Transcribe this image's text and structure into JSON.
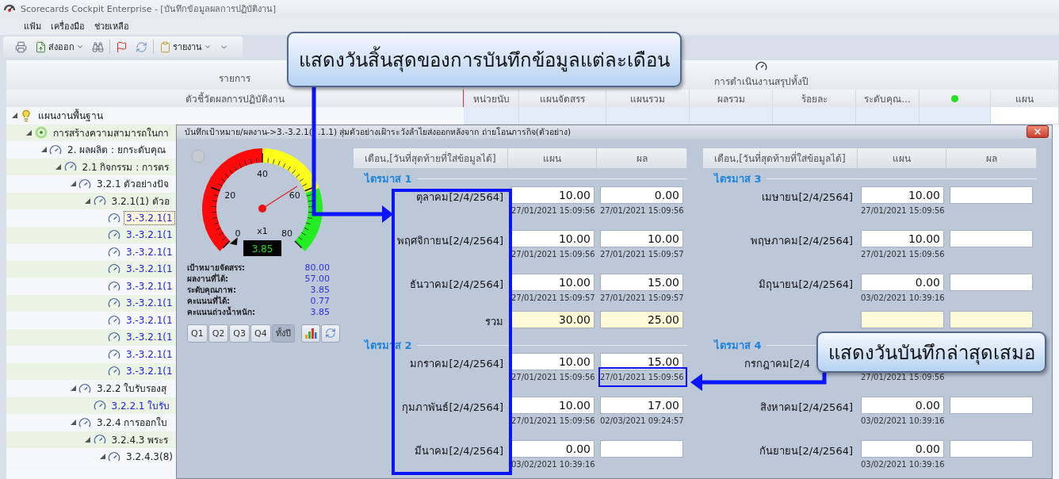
{
  "window": {
    "title": "Scorecards Cockpit Enterprise - [บันทึกข้อมูลผลการปฏิบัติงาน]"
  },
  "menu": [
    "แฟ้ม",
    "เครื่องมือ",
    "ช่วยเหลือ"
  ],
  "toolbar": [
    {
      "kind": "printer"
    },
    {
      "kind": "export",
      "label": "ส่งออก",
      "dropdown": true
    },
    {
      "kind": "binoculars"
    },
    {
      "kind": "separator"
    },
    {
      "kind": "flag"
    },
    {
      "kind": "refresh"
    },
    {
      "kind": "separator"
    },
    {
      "kind": "clipboard",
      "label": "รายงาน",
      "dropdown": true
    },
    {
      "kind": "overflow"
    }
  ],
  "grid": {
    "header_top": [
      "รายการ",
      "การดำเนินงานสรุปทั้งปี"
    ],
    "columns": [
      {
        "kind": "text",
        "label": "ตัวชี้วัดผลการปฏิบัติงาน"
      },
      {
        "kind": "text",
        "label": "หน่วยนับ"
      },
      {
        "kind": "text",
        "label": "แผนจัดสรร"
      },
      {
        "kind": "text",
        "label": "แผนรวม"
      },
      {
        "kind": "text",
        "label": "ผลรวม"
      },
      {
        "kind": "text",
        "label": "ร้อยละ"
      },
      {
        "kind": "text",
        "label": "ระดับคุณ..."
      },
      {
        "kind": "dot"
      },
      {
        "kind": "text",
        "label": "แผน"
      }
    ]
  },
  "tree": [
    {
      "label": "แผนงานพื้นฐาน",
      "kind": "bulb",
      "expanded": true,
      "selected": false,
      "children": [
        {
          "label": "การสร้างความสามารถในกา",
          "kind": "target",
          "expanded": true,
          "selected": false,
          "children": [
            {
              "label": "2. ผลผลิต : ยกระดับคุณ",
              "kind": "gauge",
              "expanded": true,
              "selected": false,
              "children": [
                {
                  "label": "2.1 กิจกรรม : การตร",
                  "kind": "gauge",
                  "expanded": true,
                  "selected": false,
                  "children": [
                    {
                      "label": "3.2.1 ตัวอย่างปัจ",
                      "kind": "gauge",
                      "expanded": true,
                      "selected": false,
                      "children": [
                        {
                          "label": "3.2.1(1) ตัวอ",
                          "kind": "gauge",
                          "expanded": true,
                          "selected": false,
                          "children": [
                            {
                              "label": "3.-3.2.1(1",
                              "kind": "gauge",
                              "selected": true
                            },
                            {
                              "label": "3.-3.2.1(1",
                              "kind": "gauge",
                              "selected": false
                            },
                            {
                              "label": "3.-3.2.1(1",
                              "kind": "gauge",
                              "selected": false
                            },
                            {
                              "label": "3.-3.2.1(1",
                              "kind": "gauge",
                              "selected": false
                            },
                            {
                              "label": "3.-3.2.1(1",
                              "kind": "gauge",
                              "selected": false
                            },
                            {
                              "label": "3.-3.2.1(1",
                              "kind": "gauge",
                              "selected": false
                            },
                            {
                              "label": "3.-3.2.1(1",
                              "kind": "gauge",
                              "selected": false
                            },
                            {
                              "label": "3.-3.2.1(1",
                              "kind": "gauge",
                              "selected": false
                            },
                            {
                              "label": "3.-3.2.1(1",
                              "kind": "gauge",
                              "selected": false
                            },
                            {
                              "label": "3.-3.2.1(1",
                              "kind": "gauge",
                              "selected": false
                            }
                          ]
                        }
                      ]
                    },
                    {
                      "label": "3.2.2 ใบรับรองสุ",
                      "kind": "gauge",
                      "expanded": true,
                      "selected": false,
                      "children": [
                        {
                          "label": "3.2.2.1 ใบรับ",
                          "kind": "gauge",
                          "selected": false
                        }
                      ]
                    },
                    {
                      "label": "3.2.4 การออกใบ",
                      "kind": "gauge",
                      "expanded": true,
                      "selected": false,
                      "children": [
                        {
                          "label": "3.2.4.3 พระร",
                          "kind": "gauge",
                          "expanded": true,
                          "selected": false,
                          "children": [
                            {
                              "label": "3.2.4.3(8)",
                              "kind": "gauge",
                              "expanded": true,
                              "selected": false
                            }
                          ]
                        }
                      ]
                    }
                  ]
                }
              ]
            }
          ]
        }
      ]
    }
  ],
  "dialog": {
    "title": [
      "บันทึกเป้าหมาย/ผลงาน->3.-3.2.1(",
      ".1.1) สุ่มตัวอย่างเฝ้าระวังลำไยส่งออกหลังจาก ถ่ายโอนภารกิจ(ตัวอย่าง)"
    ],
    "gauge": {
      "scale": [
        "0",
        "20",
        "40",
        "60",
        "80"
      ],
      "multiplier": "x1",
      "readout": "3.85",
      "level": 0.7125
    },
    "stats": [
      {
        "label": "เป้าหมายจัดสรร:",
        "value": "80.00"
      },
      {
        "label": "ผลงานที่ได้:",
        "value": "57.00"
      },
      {
        "label": "ระดับคุณภาพ:",
        "value": "3.85"
      },
      {
        "label": "คะแนนที่ได้:",
        "value": "0.77"
      },
      {
        "label": "คะแนนถ่วงน้ำหนัก:",
        "value": "3.85"
      }
    ],
    "periods": [
      {
        "label": "Q1",
        "selected": false
      },
      {
        "label": "Q2",
        "selected": false
      },
      {
        "label": "Q3",
        "selected": false
      },
      {
        "label": "Q4",
        "selected": false
      },
      {
        "label": "ทั้งปี",
        "selected": true
      }
    ],
    "tables": [
      {
        "columns": [
          "เดือน,[วันที่สุดท้ายที่ใส่ข้อมูลได้]",
          "แผน",
          "ผล"
        ],
        "quarters": [
          {
            "title": "ไตรมาส 1",
            "rows": [
              {
                "kind": "month",
                "label": "ตุลาคม[2/4/2564]",
                "plan": {
                  "value": "10.00",
                  "date": "27/01/2021 15:09:56"
                },
                "result": {
                  "value": "0.00",
                  "date": "27/01/2021 15:09:56"
                }
              },
              {
                "kind": "month",
                "label": "พฤศจิกายน[2/4/2564]",
                "plan": {
                  "value": "10.00",
                  "date": "27/01/2021 15:09:56"
                },
                "result": {
                  "value": "10.00",
                  "date": "27/01/2021 15:09:57"
                }
              },
              {
                "kind": "month",
                "label": "ธันวาคม[2/4/2564]",
                "plan": {
                  "value": "10.00",
                  "date": "27/01/2021 15:09:57"
                },
                "result": {
                  "value": "15.00",
                  "date": "27/01/2021 15:09:57"
                }
              },
              {
                "kind": "total",
                "label": "รวม",
                "plan": {
                  "value": "30.00"
                },
                "result": {
                  "value": "25.00"
                }
              }
            ]
          },
          {
            "title": "ไตรมาส 2",
            "rows": [
              {
                "kind": "month",
                "label": "มกราคม[2/4/2564]",
                "plan": {
                  "value": "10.00",
                  "date": "27/01/2021 15:09:56"
                },
                "result": {
                  "value": "15.00",
                  "date": "27/01/2021 15:09:56"
                }
              },
              {
                "kind": "month",
                "label": "กุมภาพันธ์[2/4/2564]",
                "plan": {
                  "value": "10.00",
                  "date": "27/01/2021 15:09:56"
                },
                "result": {
                  "value": "17.00",
                  "date": "02/03/2021 09:24:57"
                }
              },
              {
                "kind": "month",
                "label": "มีนาคม[2/4/2564]",
                "plan": {
                  "value": "0.00",
                  "date": "03/02/2021 10:39:16"
                }
              }
            ]
          }
        ]
      },
      {
        "columns": [
          "เดือน,[วันที่สุดท้ายที่ใส่ข้อมูลได้]",
          "แผน",
          "ผล"
        ],
        "quarters": [
          {
            "title": "ไตรมาส 3",
            "rows": [
              {
                "kind": "month",
                "label": "เมษายน[2/4/2564]",
                "plan": {
                  "value": "10.00",
                  "date": "27/01/2021 15:09:56"
                }
              },
              {
                "kind": "month",
                "label": "พฤษภาคม[2/4/2564]",
                "plan": {
                  "value": "10.00",
                  "date": "27/01/2021 15:09:56"
                }
              },
              {
                "kind": "month",
                "label": "มิถุนายน[2/4/2564]",
                "plan": {
                  "value": "0.00",
                  "date": "03/02/2021 10:39:16"
                }
              },
              {
                "kind": "total"
              }
            ]
          },
          {
            "title": "ไตรมาส 4",
            "rows": [
              {
                "kind": "partial",
                "label": "กรกฎาคม[2/4",
                "plan": {
                  "date": "27/01/2021 15:09:56"
                }
              },
              {
                "kind": "month",
                "label": "สิงหาคม[2/4/2564]",
                "plan": {
                  "value": "0.00",
                  "date": "03/02/2021 10:39:16"
                }
              },
              {
                "kind": "month",
                "label": "กันยายน[2/4/2564]",
                "plan": {
                  "value": "0.00",
                  "date": "03/02/2021 10:39:16"
                }
              }
            ]
          }
        ]
      }
    ]
  },
  "callouts": [
    {
      "text": "แสดงวันสิ้นสุดของการบันทึกข้อมูลแต่ละเดือน"
    },
    {
      "text": "แสดงวันบันทึกล่าสุดเสมอ"
    }
  ]
}
